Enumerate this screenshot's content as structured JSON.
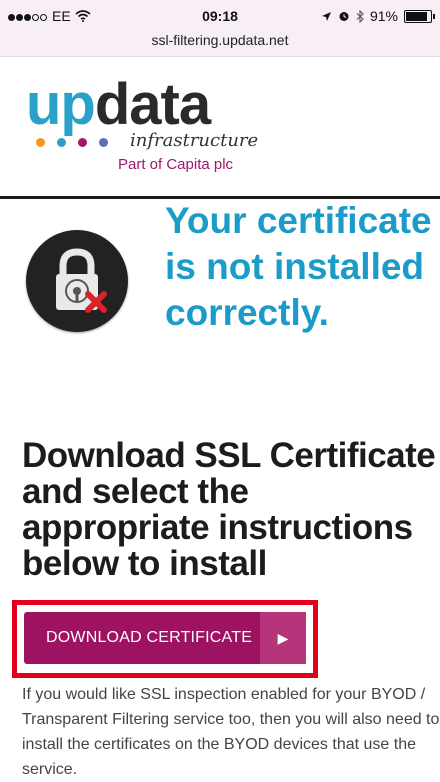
{
  "status_bar": {
    "carrier": "EE",
    "time": "09:18",
    "battery": "91%",
    "url": "ssl-filtering.updata.net",
    "icons": [
      "signal-dots-icon",
      "wifi-icon",
      "location-arrow-icon",
      "alarm-icon",
      "bluetooth-icon",
      "battery-icon"
    ]
  },
  "logo": {
    "word_up": "up",
    "word_data": "data",
    "script": "infrastructure",
    "subtitle": "Part of Capita plc",
    "dot_colors": [
      "#f29a1f",
      "#2aa1c9",
      "#a1186a",
      "#5c6fb8"
    ]
  },
  "alert": {
    "icon": "lock-error-icon",
    "headline": "Your certificate is not installed correctly."
  },
  "instructions": {
    "text": "Download SSL Certificate and select the appropriate instructions below to install"
  },
  "download_button": {
    "label": "DOWNLOAD CERTIFICATE",
    "arrow": "▶"
  },
  "info": {
    "text": "If you would like SSL inspection enabled for your BYOD / Transparent Filtering service too, then you will also need to install the certificates on the BYOD devices that use the service."
  },
  "colors": {
    "brand_blue": "#1b9cc8",
    "brand_magenta": "#9e1262",
    "highlight_red": "#e4001a"
  }
}
